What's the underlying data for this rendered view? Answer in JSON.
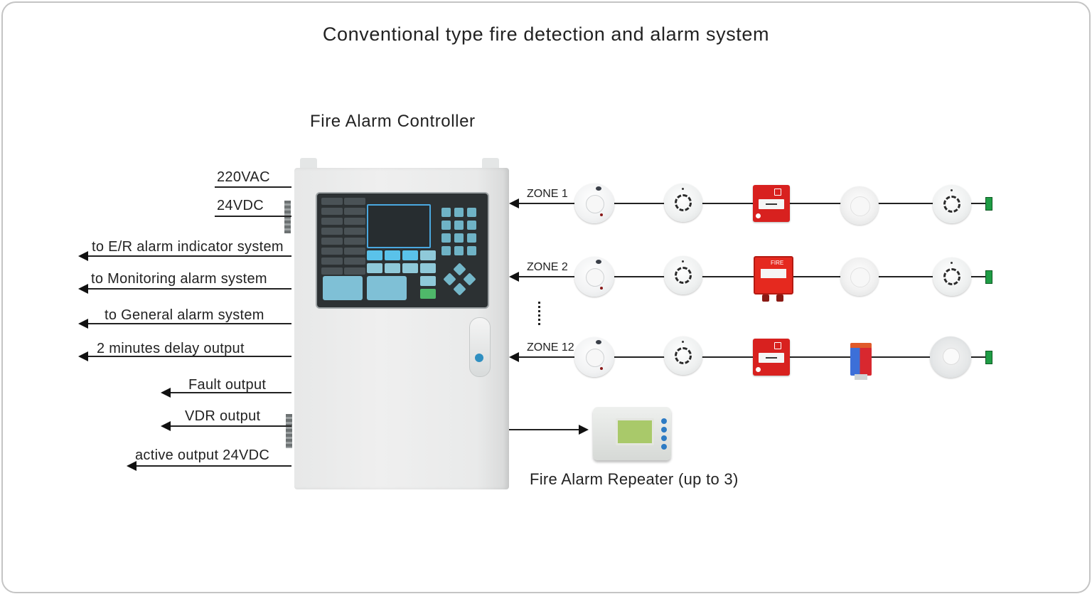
{
  "title": "Conventional type fire detection and alarm system",
  "controller": {
    "label": "Fire Alarm Controller"
  },
  "inputs": [
    {
      "label": "220VAC"
    },
    {
      "label": "24VDC"
    }
  ],
  "outputs": [
    {
      "label": "to E/R alarm indicator system"
    },
    {
      "label": "to Monitoring alarm system"
    },
    {
      "label": "to General alarm system"
    },
    {
      "label": "2 minutes delay output"
    },
    {
      "label": "Fault output"
    },
    {
      "label": "VDR output"
    },
    {
      "label": "active output 24VDC"
    }
  ],
  "zones": [
    {
      "label": "ZONE 1",
      "devices": [
        "smoke-detector",
        "heat-detector",
        "manual-call-point",
        "smoke-detector-plain",
        "heat-detector",
        "end-of-line-resistor"
      ]
    },
    {
      "label": "ZONE 2",
      "devices": [
        "smoke-detector",
        "heat-detector",
        "manual-call-point-fire",
        "smoke-detector-plain",
        "heat-detector",
        "end-of-line-resistor"
      ]
    },
    {
      "label": "ZONE 12",
      "devices": [
        "smoke-detector",
        "heat-detector",
        "manual-call-point",
        "interface-module",
        "detector-base",
        "end-of-line-resistor"
      ]
    }
  ],
  "ellipsis": "⋮",
  "repeater": {
    "label": "Fire Alarm Repeater (up to 3)"
  },
  "colors": {
    "line": "#222222",
    "alarm_red": "#d8211f",
    "eol_green": "#1f9c45",
    "panel_dark": "#2c3133",
    "key_blue": "#5ac2ea"
  }
}
